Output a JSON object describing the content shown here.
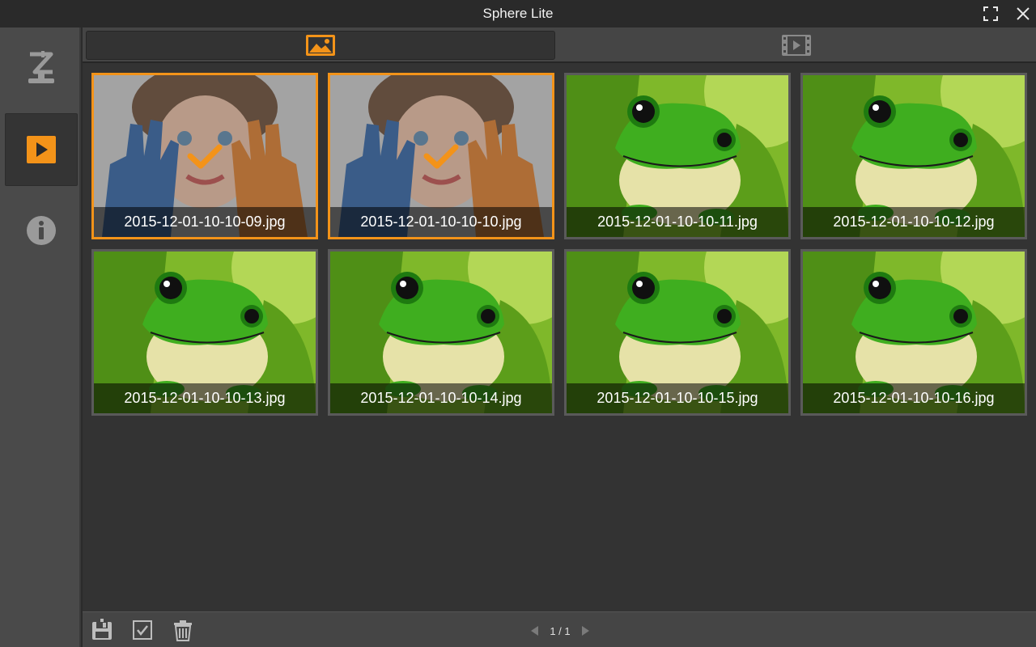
{
  "window": {
    "title": "Sphere Lite"
  },
  "sidebar": {
    "items": [
      {
        "name": "sidebar-item-device",
        "icon": "z-stand-icon",
        "active": false
      },
      {
        "name": "sidebar-item-playback",
        "icon": "play-icon",
        "active": true
      },
      {
        "name": "sidebar-item-info",
        "icon": "info-icon",
        "active": false
      }
    ]
  },
  "tabs": [
    {
      "name": "photos",
      "icon": "image-icon",
      "active": true
    },
    {
      "name": "videos",
      "icon": "film-icon",
      "active": false
    }
  ],
  "gallery": {
    "items": [
      {
        "filename": "2015-12-01-10-10-09.jpg",
        "kind": "child",
        "selected": true
      },
      {
        "filename": "2015-12-01-10-10-10.jpg",
        "kind": "child",
        "selected": true
      },
      {
        "filename": "2015-12-01-10-10-11.jpg",
        "kind": "frog",
        "selected": false
      },
      {
        "filename": "2015-12-01-10-10-12.jpg",
        "kind": "frog",
        "selected": false
      },
      {
        "filename": "2015-12-01-10-10-13.jpg",
        "kind": "frog",
        "selected": false
      },
      {
        "filename": "2015-12-01-10-10-14.jpg",
        "kind": "frog",
        "selected": false
      },
      {
        "filename": "2015-12-01-10-10-15.jpg",
        "kind": "frog",
        "selected": false
      },
      {
        "filename": "2015-12-01-10-10-16.jpg",
        "kind": "frog",
        "selected": false
      }
    ]
  },
  "footer": {
    "pager": "1 / 1",
    "buttons": [
      "save-icon",
      "select-all-icon",
      "trash-icon"
    ]
  },
  "colors": {
    "accent": "#f39319",
    "background": "#333333",
    "sidebar": "#4a4a4a"
  }
}
